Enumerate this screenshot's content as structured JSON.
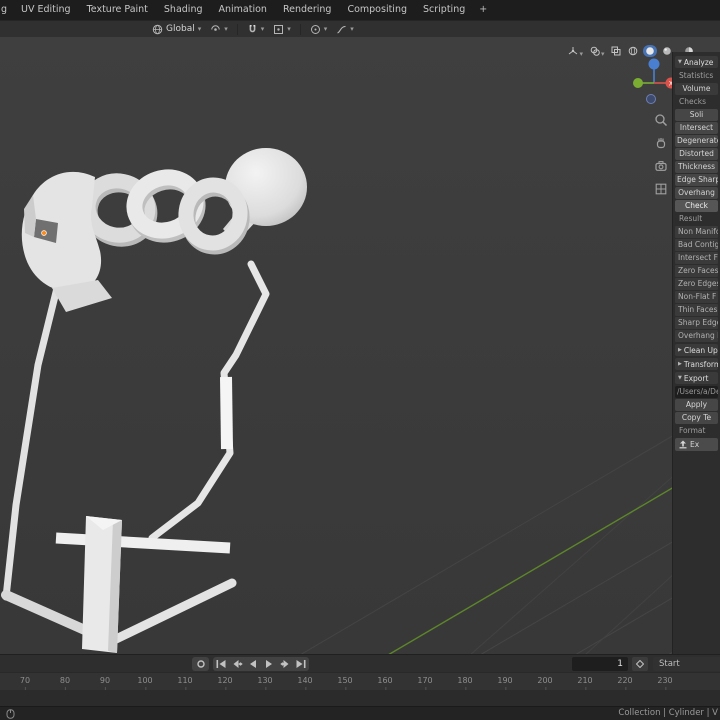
{
  "colors": {
    "accent_blue": "#4772b3",
    "axis_x_red": "#d9534b",
    "axis_y_green": "#7bad33",
    "axis_z_blue": "#4a7fd0",
    "viewport_bg": "#3b3b3b",
    "panel_bg": "#2d2d2d"
  },
  "menubar": {
    "tabs": [
      "g",
      "UV Editing",
      "Texture Paint",
      "Shading",
      "Animation",
      "Rendering",
      "Compositing",
      "Scripting"
    ],
    "add_tab": "+"
  },
  "toolbar": {
    "orientation_label": "Global"
  },
  "panel": {
    "analyze_title": "Analyze",
    "statistics_label": "Statistics",
    "volume_button": "Volume",
    "checks_label": "Checks",
    "check_buttons": [
      "Soli",
      "Intersect",
      "Degenerate",
      "Distorted",
      "Thickness",
      "Edge Sharp",
      "Overhang"
    ],
    "check_all_button": "Check",
    "result_label": "Result",
    "result_items": [
      "Non Manifold",
      "Bad Contig",
      "Intersect F",
      "Zero Faces",
      "Zero Edges",
      "Non-Flat F",
      "Thin Faces",
      "Sharp Edge",
      "Overhang F"
    ],
    "cleanup_title": "Clean Up",
    "transform_title": "Transform",
    "export_title": "Export",
    "export_path": "/Users/a/De",
    "apply_button": "Apply",
    "copy_button": "Copy Te",
    "format_label": "Format",
    "export_button": "Ex"
  },
  "timeline": {
    "frame_value": "1",
    "start_label": "Start"
  },
  "ruler": {
    "ticks": [
      "70",
      "80",
      "90",
      "100",
      "110",
      "120",
      "130",
      "140",
      "150",
      "160",
      "170",
      "180",
      "190",
      "200",
      "210",
      "220",
      "230"
    ]
  },
  "statusbar": {
    "breadcrumb": "Collection | Cylinder | V"
  }
}
